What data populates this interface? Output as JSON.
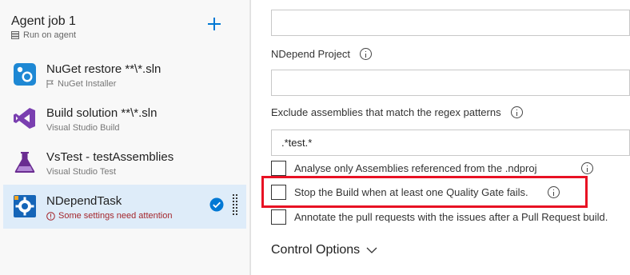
{
  "job": {
    "title": "Agent job 1",
    "subtitle": "Run on agent"
  },
  "tasks": [
    {
      "title": "NuGet restore **\\*.sln",
      "subtitle": "NuGet Installer",
      "icon": "nuget-icon"
    },
    {
      "title": "Build solution **\\*.sln",
      "subtitle": "Visual Studio Build",
      "icon": "visual-studio-icon"
    },
    {
      "title": "VsTest - testAssemblies",
      "subtitle": "Visual Studio Test",
      "icon": "flask-icon"
    },
    {
      "title": "NDependTask",
      "subtitle": "Some settings need attention",
      "icon": "ndepend-icon"
    }
  ],
  "form": {
    "ndepend_project_label": "NDepend Project",
    "ndepend_project_value": "",
    "exclude_label": "Exclude assemblies that match the regex patterns",
    "exclude_value": ".*test.*",
    "checkboxes": [
      {
        "label": "Analyse only Assemblies referenced from the .ndproj",
        "checked": false
      },
      {
        "label": "Stop the Build when at least one Quality Gate fails.",
        "checked": false
      },
      {
        "label": "Annotate the pull requests with the issues after a Pull Request build.",
        "checked": false
      }
    ],
    "control_options_label": "Control Options"
  },
  "colors": {
    "accent": "#0078d4",
    "selected_bg": "#deecf9",
    "warning": "#a4262c",
    "highlight": "#e81123"
  }
}
